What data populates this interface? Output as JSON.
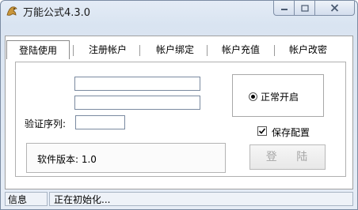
{
  "window": {
    "title": "万能公式4.3.0"
  },
  "tabs": [
    {
      "label": "登陆使用"
    },
    {
      "label": "注册帐户"
    },
    {
      "label": "帐户绑定"
    },
    {
      "label": "帐户充值"
    },
    {
      "label": "帐户改密"
    }
  ],
  "form": {
    "username_value": "",
    "password_value": "",
    "verify_label": "验证序列:",
    "verify_value": "",
    "version_text": "软件版本: 1.0",
    "radio_label": "正常开启",
    "save_label": "保存配置",
    "login_label": "登 陆"
  },
  "status": {
    "info": "信息",
    "message": "正在初始化..."
  },
  "colors": {
    "frame": "#d9e4f1",
    "disabled_text": "#a6a6a6"
  }
}
